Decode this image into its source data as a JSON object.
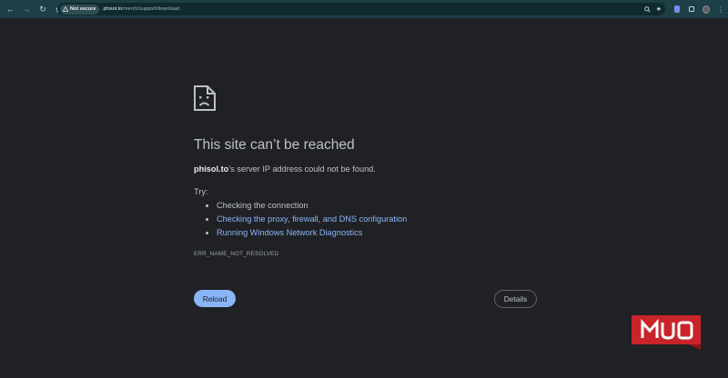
{
  "browser": {
    "security_chip_label": "Not secure",
    "url_host": "phisol.to",
    "url_path": "/merch/support/download",
    "icons": [
      "back-icon",
      "forward-icon",
      "reload-icon",
      "home-icon",
      "info-icon",
      "zoom-icon",
      "star-icon",
      "extension-icon",
      "puzzle-icon",
      "profile-avatar"
    ],
    "accent": "#1d3f45"
  },
  "error": {
    "title": "This site can’t be reached",
    "host": "phisol.to",
    "description_suffix": "’s server IP address could not be found.",
    "try_label": "Try:",
    "suggestions": [
      "Checking the connection",
      "Checking the proxy, firewall, and DNS configuration",
      "Running Windows Network Diagnostics"
    ],
    "code": "ERR_NAME_NOT_RESOLVED",
    "reload_label": "Reload",
    "details_label": "Details",
    "link_color": "#8ab4f8"
  },
  "watermark": {
    "text": "MUO",
    "color": "#c9242b"
  }
}
